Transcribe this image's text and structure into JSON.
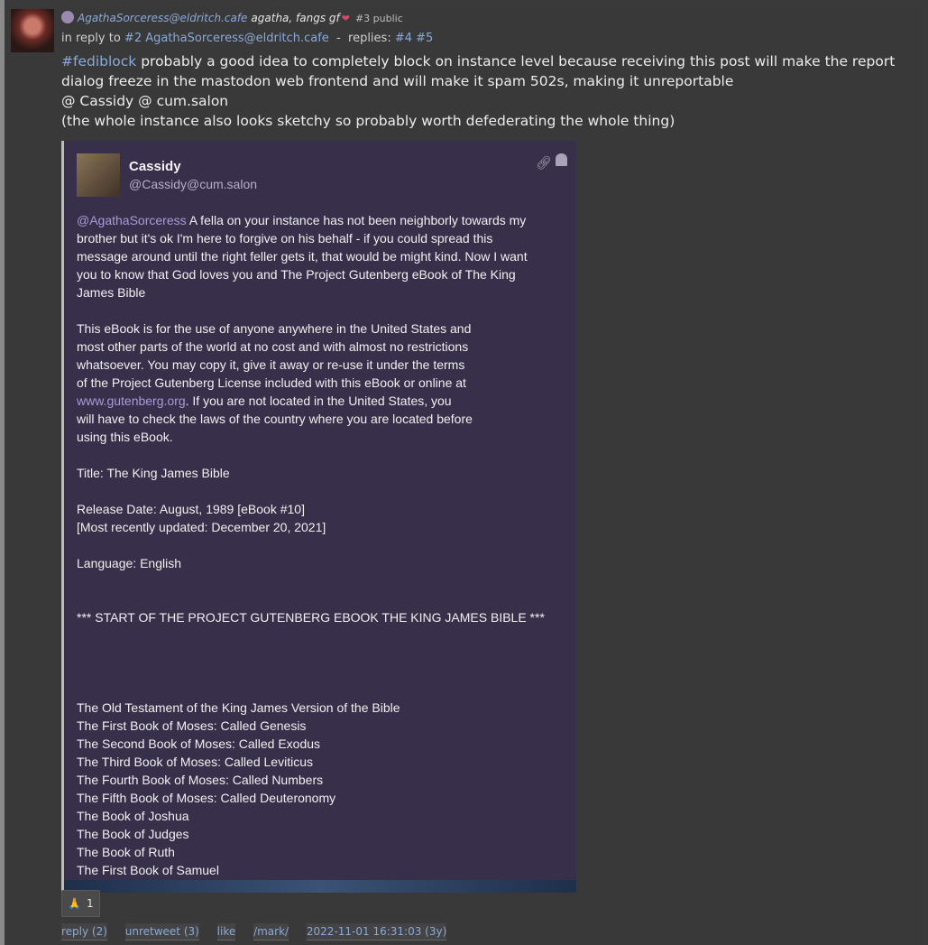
{
  "post": {
    "author_handle": "AgathaSorceress@eldritch.cafe",
    "author_name": "agatha, fangs gf",
    "heart": "❤",
    "number_visibility": "#3 public",
    "reply_prefix": "in reply to",
    "reply_target": "#2 AgathaSorceress@eldritch.cafe",
    "reply_sep": "-",
    "replies_label": "replies:",
    "replies": [
      "#4",
      "#5"
    ],
    "hashtag": "#fediblock",
    "line1": " probably a good idea to completely block on instance level because receiving this post will make the report dialog freeze in the mastodon web frontend and will make it spam 502s, making it unreportable",
    "line2": "@ Cassidy @ cum.salon",
    "line3": "(the whole instance also looks sketchy so probably worth defederating the whole thing)"
  },
  "embed": {
    "name": "Cassidy",
    "handle": "@Cassidy@cum.salon",
    "mention": "@AgathaSorceress",
    "text_before_url": " A fella on your instance has not been neighborly towards my\nbrother but it's ok I'm here to forgive on his behalf - if you could spread this\nmessage around until the right feller gets it, that would be might kind. Now I want\nyou to know that God loves you and The Project Gutenberg eBook of The King\nJames Bible\n\nThis eBook is for the use of anyone anywhere in the United States and\nmost other parts of the world at no cost and with almost no restrictions\nwhatsoever. You may copy it, give it away or re-use it under the terms\nof the Project Gutenberg License included with this eBook or online at\n",
    "url": "www.gutenberg.org",
    "text_after_url": ". If you are not located in the United States, you\nwill have to check the laws of the country where you are located before\nusing this eBook.\n\nTitle: The King James Bible\n\nRelease Date: August, 1989 [eBook #10]\n[Most recently updated: December 20, 2021]\n\nLanguage: English\n\n\n*** START OF THE PROJECT GUTENBERG EBOOK THE KING JAMES BIBLE ***\n\n\n\n\nThe Old Testament of the King James Version of the Bible\nThe First Book of Moses: Called Genesis\nThe Second Book of Moses: Called Exodus\nThe Third Book of Moses: Called Leviticus\nThe Fourth Book of Moses: Called Numbers\nThe Fifth Book of Moses: Called Deuteronomy\nThe Book of Joshua\nThe Book of Judges\nThe Book of Ruth\nThe First Book of Samuel"
  },
  "reaction": {
    "emoji": "🙏",
    "count": "1"
  },
  "actions": {
    "reply": "reply (2)",
    "unretweet": "unretweet (3)",
    "like": "like",
    "mark": "/mark/",
    "timestamp": "2022-11-01 16:31:03 (3y)"
  }
}
